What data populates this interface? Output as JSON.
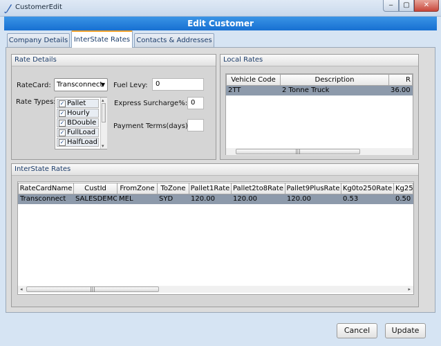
{
  "window": {
    "title": "CustomerEdit",
    "minimize": "‒",
    "maximize": "▢",
    "close": "✕"
  },
  "header": {
    "title": "Edit Customer"
  },
  "tabs": [
    {
      "label": "Company Details"
    },
    {
      "label": "InterState Rates"
    },
    {
      "label": "Contacts & Addresses"
    }
  ],
  "rate_details": {
    "title": "Rate Details",
    "ratecard_label": "RateCard:",
    "ratecard_value": "Transconnect",
    "rate_types_label": "Rate Types:",
    "rate_types": [
      {
        "label": "Pallet",
        "checked": true
      },
      {
        "label": "Hourly",
        "checked": true
      },
      {
        "label": "BDouble",
        "checked": true
      },
      {
        "label": "FullLoad",
        "checked": true
      },
      {
        "label": "HalfLoad",
        "checked": true
      }
    ],
    "fuel_levy_label": "Fuel Levy:",
    "fuel_levy_value": "0",
    "express_label": "Express Surcharge%:",
    "express_value": "0",
    "payment_label": "Payment Terms(days)",
    "payment_value": ""
  },
  "local_rates": {
    "title": "Local Rates",
    "columns": [
      "Vehicle Code",
      "Description",
      "R"
    ],
    "rows": [
      [
        "2TT",
        "2 Tonne Truck",
        "36.00"
      ]
    ]
  },
  "interstate_rates": {
    "title": "InterState Rates",
    "columns": [
      "RateCardName",
      "CustId",
      "FromZone",
      "ToZone",
      "Pallet1Rate",
      "Pallet2to8Rate",
      "Pallet9PlusRate",
      "Kg0to250Rate",
      "Kg25"
    ],
    "rows": [
      [
        "Transconnect",
        "SALESDEMO",
        "MEL",
        "SYD",
        "120.00",
        "120.00",
        "120.00",
        "0.53",
        "0.50"
      ]
    ]
  },
  "buttons": {
    "cancel": "Cancel",
    "update": "Update"
  },
  "icons": {
    "check": "✓",
    "dropdown": "▼",
    "scroll_left": "◂",
    "scroll_right": "▸",
    "scroll_up": "▴",
    "scroll_down": "▾",
    "thumb_grip": "|||"
  }
}
